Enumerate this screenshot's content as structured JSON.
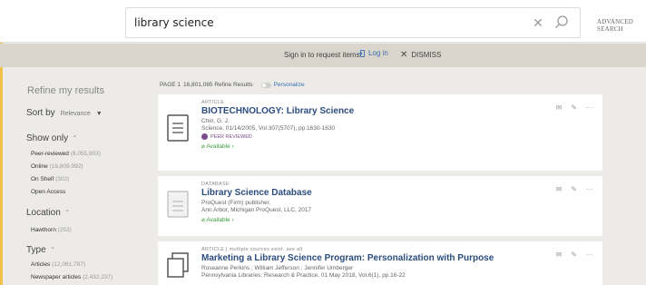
{
  "search": {
    "query": "library science",
    "advanced_label": "ADVANCED SEARCH"
  },
  "signin": {
    "message": "Sign in to request items",
    "login": "Log in",
    "dismiss": "DISMISS"
  },
  "sidebar": {
    "title": "Refine my results",
    "sort_label": "Sort by",
    "sort_value": "Relevance",
    "show_only": {
      "title": "Show only",
      "items": [
        {
          "label": "Peer-reviewed",
          "count": "(8,055,903)"
        },
        {
          "label": "Online",
          "count": "(16,809,992)"
        },
        {
          "label": "On Shelf",
          "count": "(302)"
        },
        {
          "label": "Open Access",
          "count": ""
        }
      ]
    },
    "location": {
      "title": "Location",
      "items": [
        {
          "label": "Hawthorn",
          "count": "(253)"
        }
      ]
    },
    "type": {
      "title": "Type",
      "items": [
        {
          "label": "Articles",
          "count": "(12,061,787)"
        },
        {
          "label": "Newspaper articles",
          "count": "(2,432,237)"
        }
      ]
    }
  },
  "results_header": {
    "page": "PAGE 1",
    "count": "16,801,085 Refine Results",
    "personalize": "Personalize"
  },
  "results": [
    {
      "type": "ARTICLE",
      "title": "BIOTECHNOLOGY: Library Science",
      "lines": [
        "Chin, G. J.",
        "Science, 01/14/2005, Vol.307(5707), pp.1630-1630"
      ],
      "peer_reviewed": "PEER REVIEWED",
      "availability": "Available"
    },
    {
      "type": "DATABASE",
      "title": "Library Science Database",
      "lines": [
        "ProQuest (Firm) publisher.",
        "Ann Arbor, Michigan ProQuest, LLC, 2017"
      ],
      "peer_reviewed": "",
      "availability": "Available"
    },
    {
      "type": "ARTICLE | multiple sources exist. see all",
      "title": "Marketing a Library Science Program: Personalization with Purpose",
      "lines": [
        "Roseanne Perkins ; William Jefferson ; Jennifer Umberger",
        "Pennsylvania Libraries: Research & Practice, 01 May 2018, Vol.6(1), pp.16-22"
      ],
      "peer_reviewed": "",
      "availability": ""
    }
  ],
  "colors": {
    "accent": "#3d6fb5",
    "title": "#2b4c7e",
    "available": "#3b9a3b",
    "peer": "#7a4b8a"
  }
}
